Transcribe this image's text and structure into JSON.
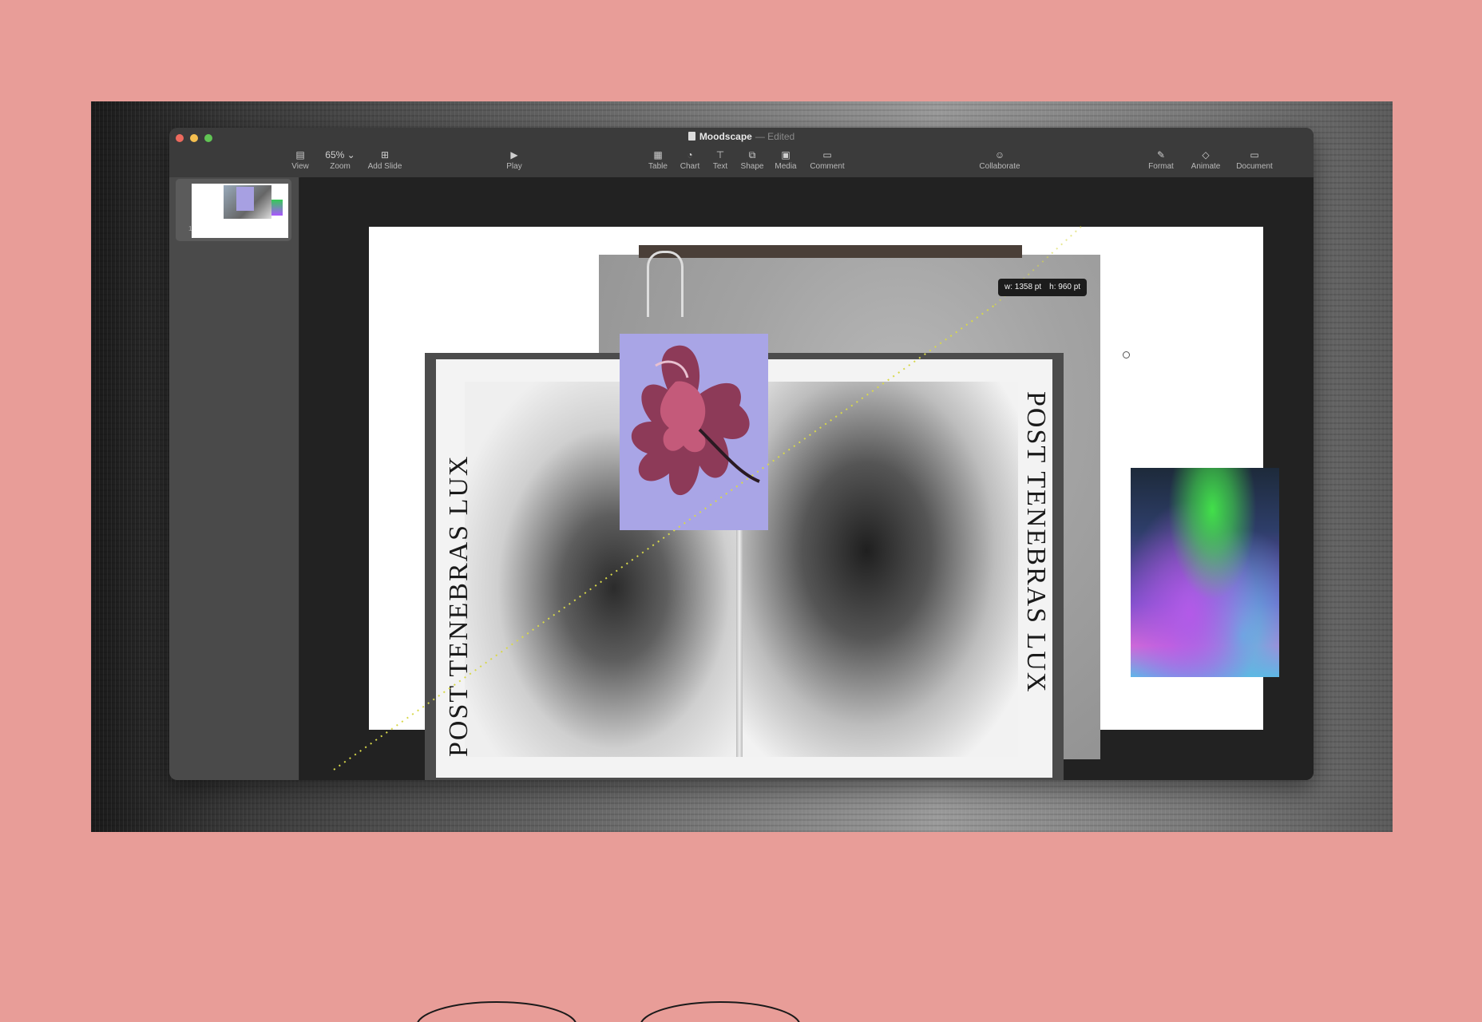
{
  "window": {
    "doc_name": "Moodscape",
    "edited": "— Edited"
  },
  "toolbar": {
    "view": "View",
    "zoom_value": "65%",
    "zoom": "Zoom",
    "add_slide": "Add Slide",
    "play": "Play",
    "table": "Table",
    "chart": "Chart",
    "text": "Text",
    "shape": "Shape",
    "media": "Media",
    "comment": "Comment",
    "collaborate": "Collaborate",
    "format": "Format",
    "animate": "Animate",
    "document": "Document"
  },
  "sidebar": {
    "slide_number": "1"
  },
  "slide": {
    "vertical_text_left": "POST TENEBRAS LUX",
    "vertical_text_right": "POST TENEBRAS LUX"
  },
  "tooltip": {
    "width": "w: 1358 pt",
    "height": "h: 960 pt"
  },
  "colors": {
    "background": "#e89d98",
    "toolbar": "#3b3b3b",
    "canvas": "#222222",
    "flower_bg": "#a9a5e6"
  }
}
